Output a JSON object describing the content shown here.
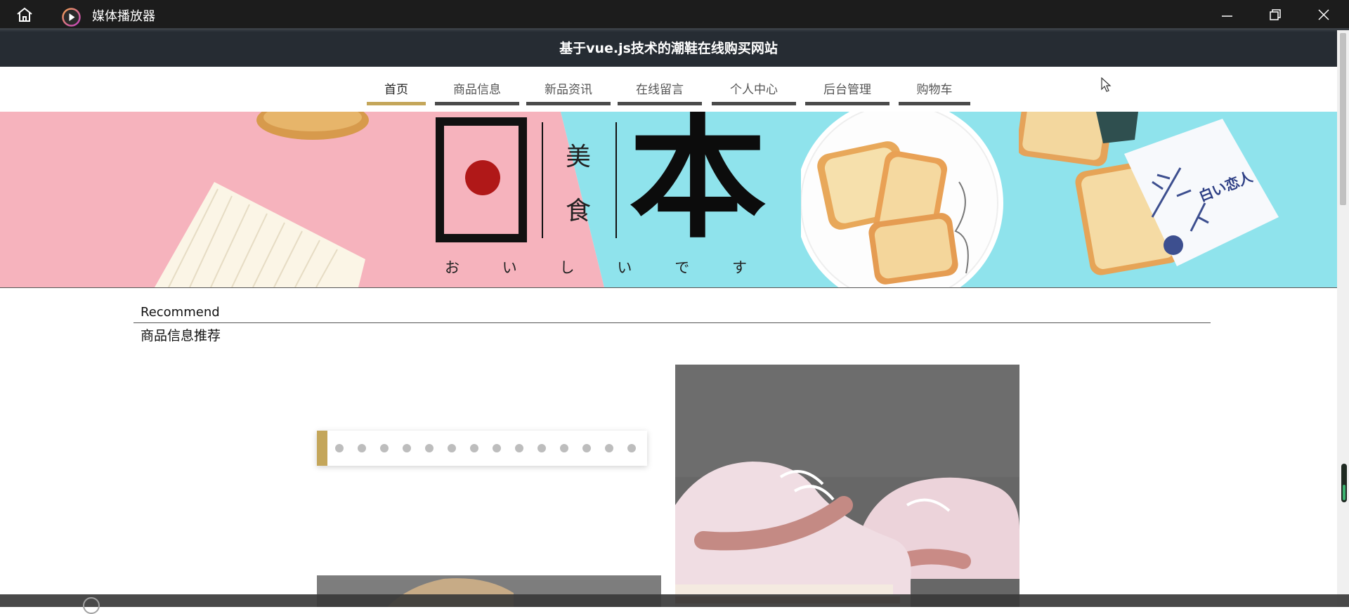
{
  "window": {
    "app_title": "媒体播放器",
    "icons": [
      "home-icon",
      "media-player-icon",
      "minimize-icon",
      "maximize-icon",
      "close-icon"
    ]
  },
  "site": {
    "header_title": "基于vue.js技术的潮鞋在线购买网站"
  },
  "nav": {
    "items": [
      {
        "label": "首页",
        "active": true
      },
      {
        "label": "商品信息",
        "active": false
      },
      {
        "label": "新品资讯",
        "active": false
      },
      {
        "label": "在线留言",
        "active": false
      },
      {
        "label": "个人中心",
        "active": false
      },
      {
        "label": "后台管理",
        "active": false
      },
      {
        "label": "购物车",
        "active": false
      }
    ],
    "accent_color": "#c4a65a"
  },
  "banner": {
    "big_char_1": "日",
    "big_char_2": "本",
    "small_chars": [
      "美",
      "食"
    ],
    "kana": [
      "お",
      "い",
      "し",
      "い",
      "で",
      "す"
    ],
    "package_text": "白い恋人"
  },
  "recommend": {
    "title_en": "Recommend",
    "title_cn": "商品信息推荐",
    "carousel_dot_count": 14
  }
}
